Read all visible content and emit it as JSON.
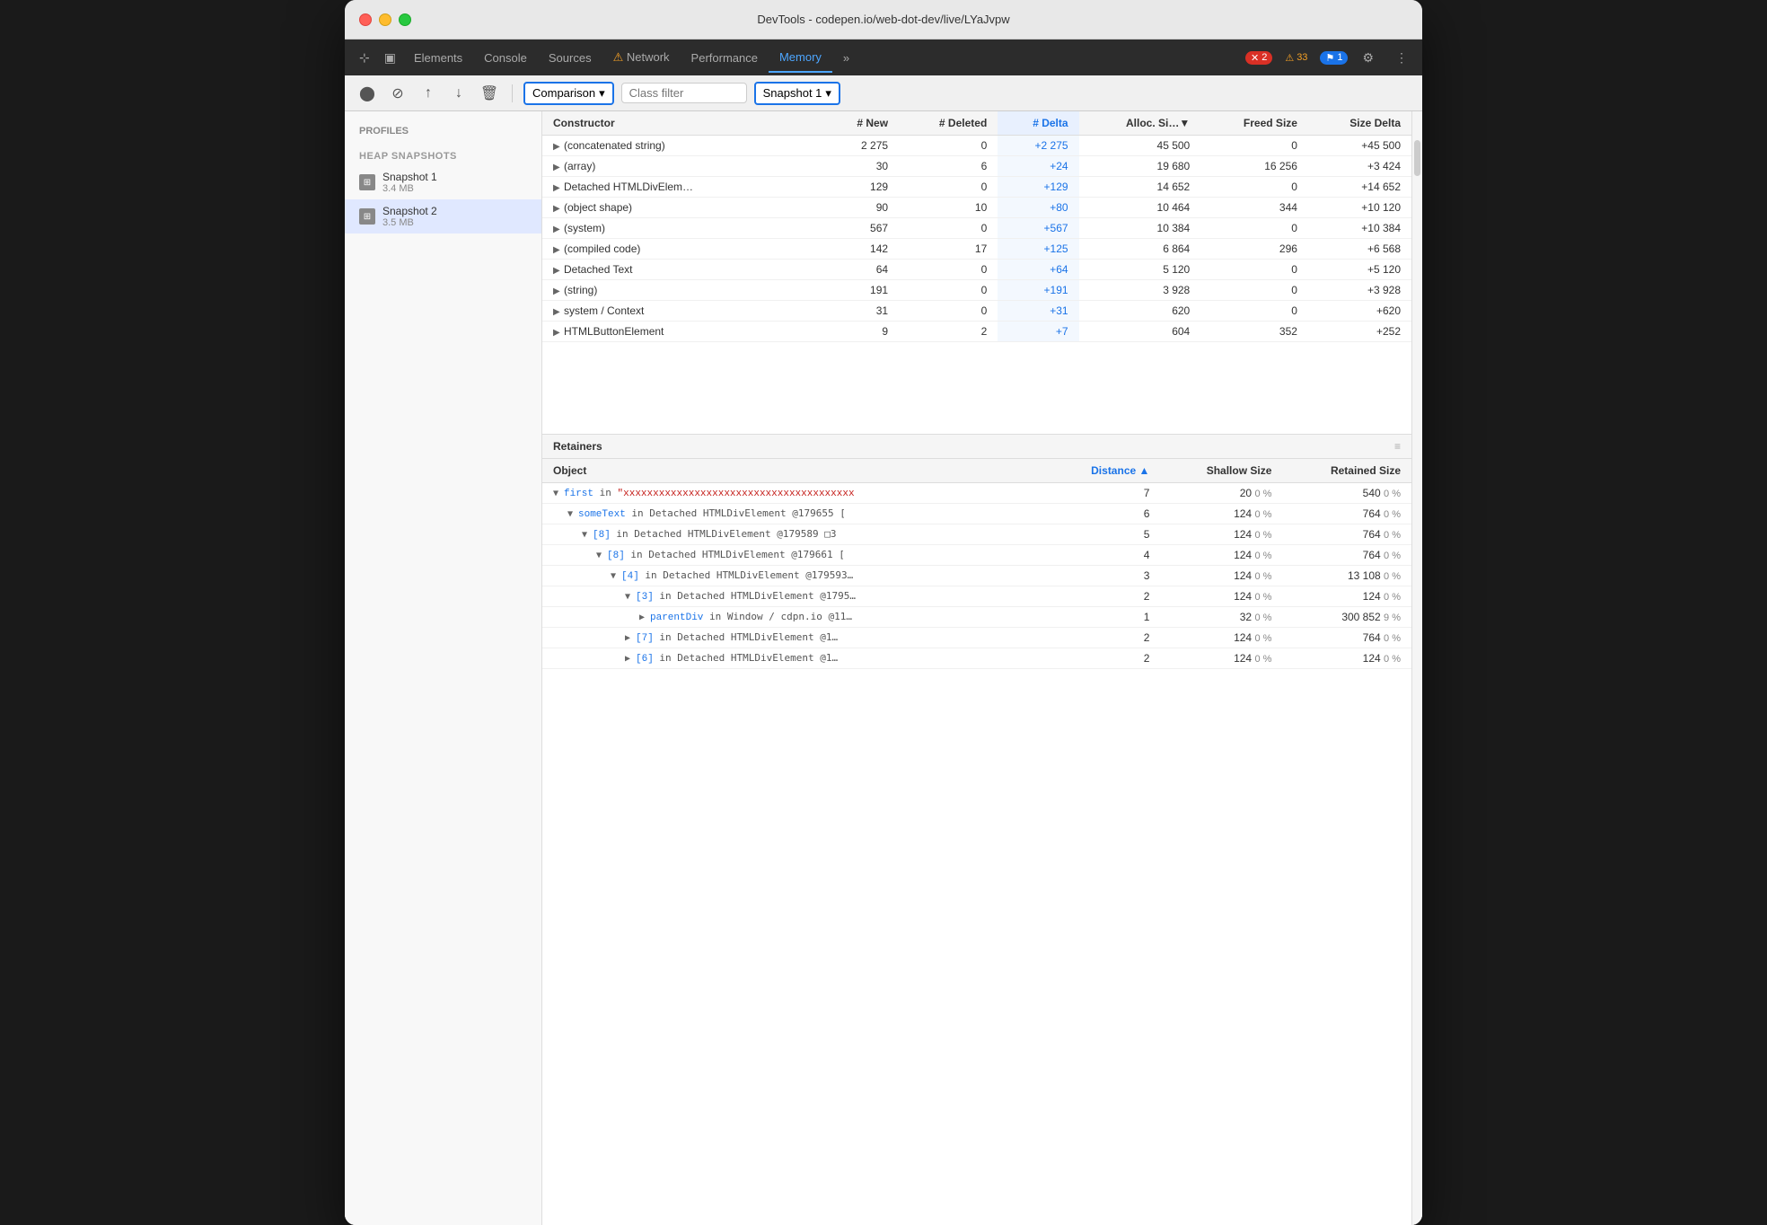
{
  "window": {
    "title": "DevTools - codepen.io/web-dot-dev/live/LYaJvpw"
  },
  "tabs": [
    {
      "id": "elements",
      "label": "Elements",
      "active": false
    },
    {
      "id": "console",
      "label": "Console",
      "active": false
    },
    {
      "id": "sources",
      "label": "Sources",
      "active": false
    },
    {
      "id": "network",
      "label": "Network",
      "active": false,
      "icon": "⚠️"
    },
    {
      "id": "performance",
      "label": "Performance",
      "active": false
    },
    {
      "id": "memory",
      "label": "Memory",
      "active": true
    },
    {
      "id": "more",
      "label": "»",
      "active": false
    }
  ],
  "badges": {
    "errors": "2",
    "warnings": "33",
    "info": "1"
  },
  "toolbar": {
    "comparison_label": "Comparison",
    "class_filter_placeholder": "Class filter",
    "snapshot_label": "Snapshot 1"
  },
  "sidebar": {
    "profiles_title": "Profiles",
    "heap_snapshots_title": "HEAP SNAPSHOTS",
    "snapshots": [
      {
        "name": "Snapshot 1",
        "size": "3.4 MB",
        "active": false
      },
      {
        "name": "Snapshot 2",
        "size": "3.5 MB",
        "active": true
      }
    ]
  },
  "table": {
    "columns": [
      "Constructor",
      "# New",
      "# Deleted",
      "# Delta",
      "Alloc. Si…",
      "Freed Size",
      "Size Delta"
    ],
    "rows": [
      {
        "constructor": "(concatenated string)",
        "new": "2 275",
        "deleted": "0",
        "delta": "+2 275",
        "allocSize": "45 500",
        "freedSize": "0",
        "sizeDelta": "+45 500"
      },
      {
        "constructor": "(array)",
        "new": "30",
        "deleted": "6",
        "delta": "+24",
        "allocSize": "19 680",
        "freedSize": "16 256",
        "sizeDelta": "+3 424"
      },
      {
        "constructor": "Detached HTMLDivElem…",
        "new": "129",
        "deleted": "0",
        "delta": "+129",
        "allocSize": "14 652",
        "freedSize": "0",
        "sizeDelta": "+14 652"
      },
      {
        "constructor": "(object shape)",
        "new": "90",
        "deleted": "10",
        "delta": "+80",
        "allocSize": "10 464",
        "freedSize": "344",
        "sizeDelta": "+10 120"
      },
      {
        "constructor": "(system)",
        "new": "567",
        "deleted": "0",
        "delta": "+567",
        "allocSize": "10 384",
        "freedSize": "0",
        "sizeDelta": "+10 384"
      },
      {
        "constructor": "(compiled code)",
        "new": "142",
        "deleted": "17",
        "delta": "+125",
        "allocSize": "6 864",
        "freedSize": "296",
        "sizeDelta": "+6 568"
      },
      {
        "constructor": "Detached Text",
        "new": "64",
        "deleted": "0",
        "delta": "+64",
        "allocSize": "5 120",
        "freedSize": "0",
        "sizeDelta": "+5 120"
      },
      {
        "constructor": "(string)",
        "new": "191",
        "deleted": "0",
        "delta": "+191",
        "allocSize": "3 928",
        "freedSize": "0",
        "sizeDelta": "+3 928"
      },
      {
        "constructor": "system / Context",
        "new": "31",
        "deleted": "0",
        "delta": "+31",
        "allocSize": "620",
        "freedSize": "0",
        "sizeDelta": "+620"
      },
      {
        "constructor": "HTMLButtonElement",
        "new": "9",
        "deleted": "2",
        "delta": "+7",
        "allocSize": "604",
        "freedSize": "352",
        "sizeDelta": "+252"
      }
    ]
  },
  "retainers": {
    "title": "Retainers",
    "columns": [
      "Object",
      "Distance ▲",
      "Shallow Size",
      "Retained Size"
    ],
    "rows": [
      {
        "indent": 0,
        "prefix": "▼",
        "object": "first",
        "in_text": " in ",
        "ref": "\"xxxxxxxxxxxxxxxxxxxxxxxxxxxxxxxxxxxxxxx",
        "distance": "7",
        "shallowSize": "20",
        "shallowPct": "0 %",
        "retainedSize": "540",
        "retainedPct": "0 %"
      },
      {
        "indent": 1,
        "prefix": "▼",
        "object": "someText",
        "in_text": " in Detached HTMLDivElement @179655 [",
        "ref": "",
        "distance": "6",
        "shallowSize": "124",
        "shallowPct": "0 %",
        "retainedSize": "764",
        "retainedPct": "0 %"
      },
      {
        "indent": 2,
        "prefix": "▼",
        "object": "[8]",
        "in_text": " in Detached HTMLDivElement @179589 □3",
        "ref": "",
        "distance": "5",
        "shallowSize": "124",
        "shallowPct": "0 %",
        "retainedSize": "764",
        "retainedPct": "0 %"
      },
      {
        "indent": 3,
        "prefix": "▼",
        "object": "[8]",
        "in_text": " in Detached HTMLDivElement @179661 [",
        "ref": "",
        "distance": "4",
        "shallowSize": "124",
        "shallowPct": "0 %",
        "retainedSize": "764",
        "retainedPct": "0 %"
      },
      {
        "indent": 4,
        "prefix": "▼",
        "object": "[4]",
        "in_text": " in Detached HTMLDivElement @179593…",
        "ref": "",
        "distance": "3",
        "shallowSize": "124",
        "shallowPct": "0 %",
        "retainedSize": "13 108",
        "retainedPct": "0 %"
      },
      {
        "indent": 5,
        "prefix": "▼",
        "object": "[3]",
        "in_text": " in Detached HTMLDivElement @1795…",
        "ref": "",
        "distance": "2",
        "shallowSize": "124",
        "shallowPct": "0 %",
        "retainedSize": "124",
        "retainedPct": "0 %"
      },
      {
        "indent": 6,
        "prefix": "▶",
        "object": "parentDiv",
        "in_text": " in Window / cdpn.io @11…",
        "ref": "",
        "distance": "1",
        "shallowSize": "32",
        "shallowPct": "0 %",
        "retainedSize": "300 852",
        "retainedPct": "9 %"
      },
      {
        "indent": 5,
        "prefix": "▶",
        "object": "[7]",
        "in_text": " in Detached HTMLDivElement @1…",
        "ref": "",
        "distance": "2",
        "shallowSize": "124",
        "shallowPct": "0 %",
        "retainedSize": "764",
        "retainedPct": "0 %"
      },
      {
        "indent": 5,
        "prefix": "▶",
        "object": "[6]",
        "in_text": " in Detached HTMLDivElement @1…",
        "ref": "",
        "distance": "2",
        "shallowSize": "124",
        "shallowPct": "0 %",
        "retainedSize": "124",
        "retainedPct": "0 %"
      }
    ]
  }
}
